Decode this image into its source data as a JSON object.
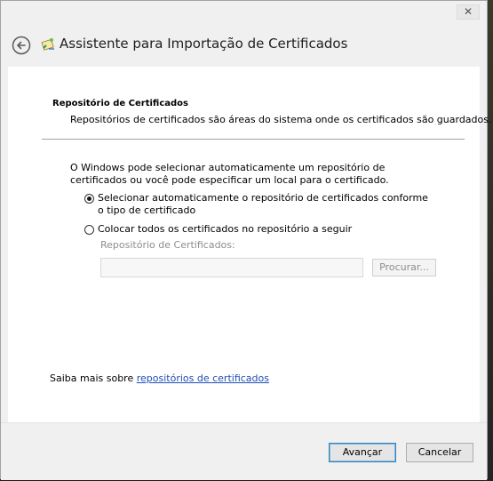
{
  "window": {
    "close_glyph": "✕"
  },
  "header": {
    "title": "Assistente para Importação de Certificados",
    "back_icon": "back-arrow-icon",
    "wizard_icon": "certificate-wizard-icon"
  },
  "page": {
    "section_title": "Repositório de Certificados",
    "section_description": "Repositórios de certificados são áreas do sistema onde os certificados são guardados.",
    "intro_text": "O Windows pode selecionar automaticamente um repositório de certificados ou você pode especificar um local para o certificado.",
    "options": [
      {
        "label": "Selecionar automaticamente o repositório de certificados conforme o tipo de certificado",
        "checked": true
      },
      {
        "label": "Colocar todos os certificados no repositório a seguir",
        "checked": false
      }
    ],
    "store_label": "Repositório de Certificados:",
    "store_value": "",
    "browse_label": "Procurar...",
    "learn_more_prefix": "Saiba mais sobre ",
    "learn_more_link": "repositórios de certificados"
  },
  "footer": {
    "next_label": "Avançar",
    "cancel_label": "Cancelar"
  },
  "colors": {
    "link": "#1f4fb3",
    "disabled_text": "#8d8d8d",
    "primary_border": "#3c7fb1"
  }
}
